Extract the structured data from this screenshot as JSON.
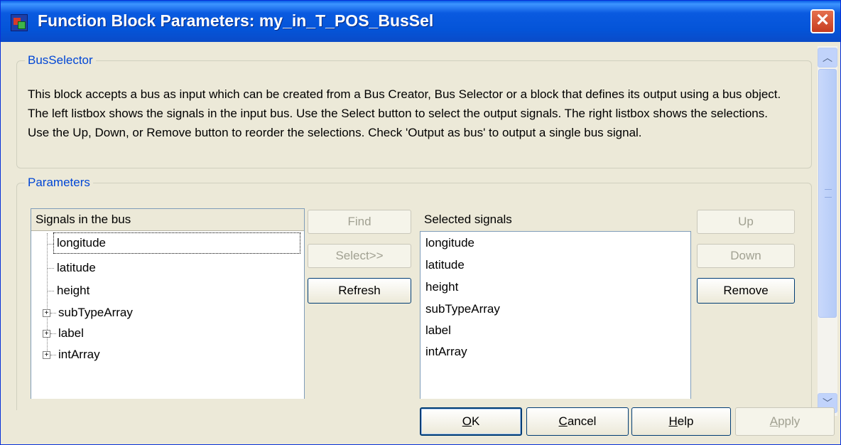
{
  "window": {
    "title": "Function Block Parameters: my_in_T_POS_BusSel",
    "close_glyph": "✕"
  },
  "bus_selector": {
    "legend": "BusSelector",
    "description": "This block accepts a bus as input which can be created from a Bus Creator, Bus Selector or a block that defines its output using a bus object. The left listbox shows the signals in the input bus. Use the Select button to select the output signals. The right listbox shows the selections. Use the Up, Down, or Remove button to reorder the selections. Check 'Output as bus' to output a single bus signal."
  },
  "parameters": {
    "legend": "Parameters",
    "signals_header": "Signals in the bus",
    "signals": [
      {
        "label": "longitude",
        "expandable": false
      },
      {
        "label": "latitude",
        "expandable": false
      },
      {
        "label": "height",
        "expandable": false
      },
      {
        "label": "subTypeArray",
        "expandable": true
      },
      {
        "label": "label",
        "expandable": true
      },
      {
        "label": "intArray",
        "expandable": true
      }
    ],
    "buttons": {
      "find": "Find",
      "select": "Select>>",
      "refresh": "Refresh",
      "up": "Up",
      "down": "Down",
      "remove": "Remove"
    },
    "selected_header": "Selected signals",
    "selected": [
      "longitude",
      "latitude",
      "height",
      "subTypeArray",
      "label",
      "intArray"
    ]
  },
  "footer": {
    "ok": {
      "mnemonic": "O",
      "rest": "K"
    },
    "cancel": {
      "mnemonic": "C",
      "rest": "ancel"
    },
    "help": {
      "mnemonic": "H",
      "rest": "elp"
    },
    "apply": {
      "mnemonic": "A",
      "rest": "pply"
    }
  },
  "icons": {
    "expander": "plus-box-icon",
    "scroll_up": "chevron-up-icon",
    "scroll_down": "chevron-down-icon"
  },
  "colors": {
    "titlebar": "#0a5ae0",
    "legend_text": "#0046d5",
    "dialog_bg": "#ece9d8",
    "close_button": "#c63c20"
  }
}
